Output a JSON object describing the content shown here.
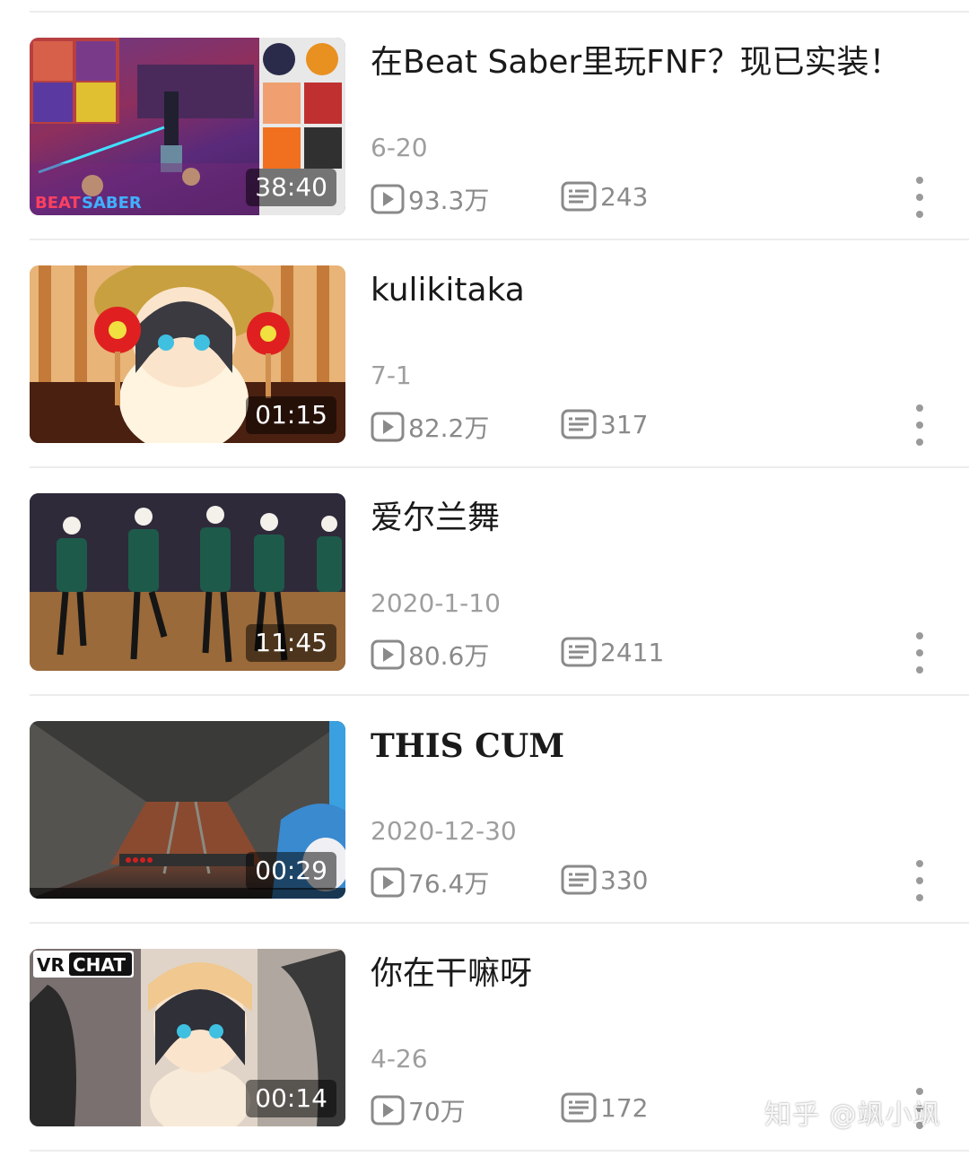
{
  "videos": [
    {
      "title": "在Beat Saber里玩FNF？现已实装！",
      "date": "6-20",
      "views": "93.3万",
      "comments": "243",
      "duration": "38:40",
      "thumb_text": "BEAT SABER"
    },
    {
      "title": "kulikitaka",
      "date": "7-1",
      "views": "82.2万",
      "comments": "317",
      "duration": "01:15"
    },
    {
      "title": "爱尔兰舞",
      "date": "2020-1-10",
      "views": "80.6万",
      "comments": "2411",
      "duration": "11:45"
    },
    {
      "title": "THIS CUM",
      "date": "2020-12-30",
      "views": "76.4万",
      "comments": "330",
      "duration": "00:29"
    },
    {
      "title": "你在干嘛呀",
      "date": "4-26",
      "views": "70万",
      "comments": "172",
      "duration": "00:14",
      "thumb_text_a": "VR",
      "thumb_text_b": "CHAT"
    }
  ],
  "watermark": "知乎 @飒小飒",
  "icons": {
    "views": "play-count-icon",
    "comments": "danmaku-icon",
    "more": "more-vertical-icon"
  }
}
